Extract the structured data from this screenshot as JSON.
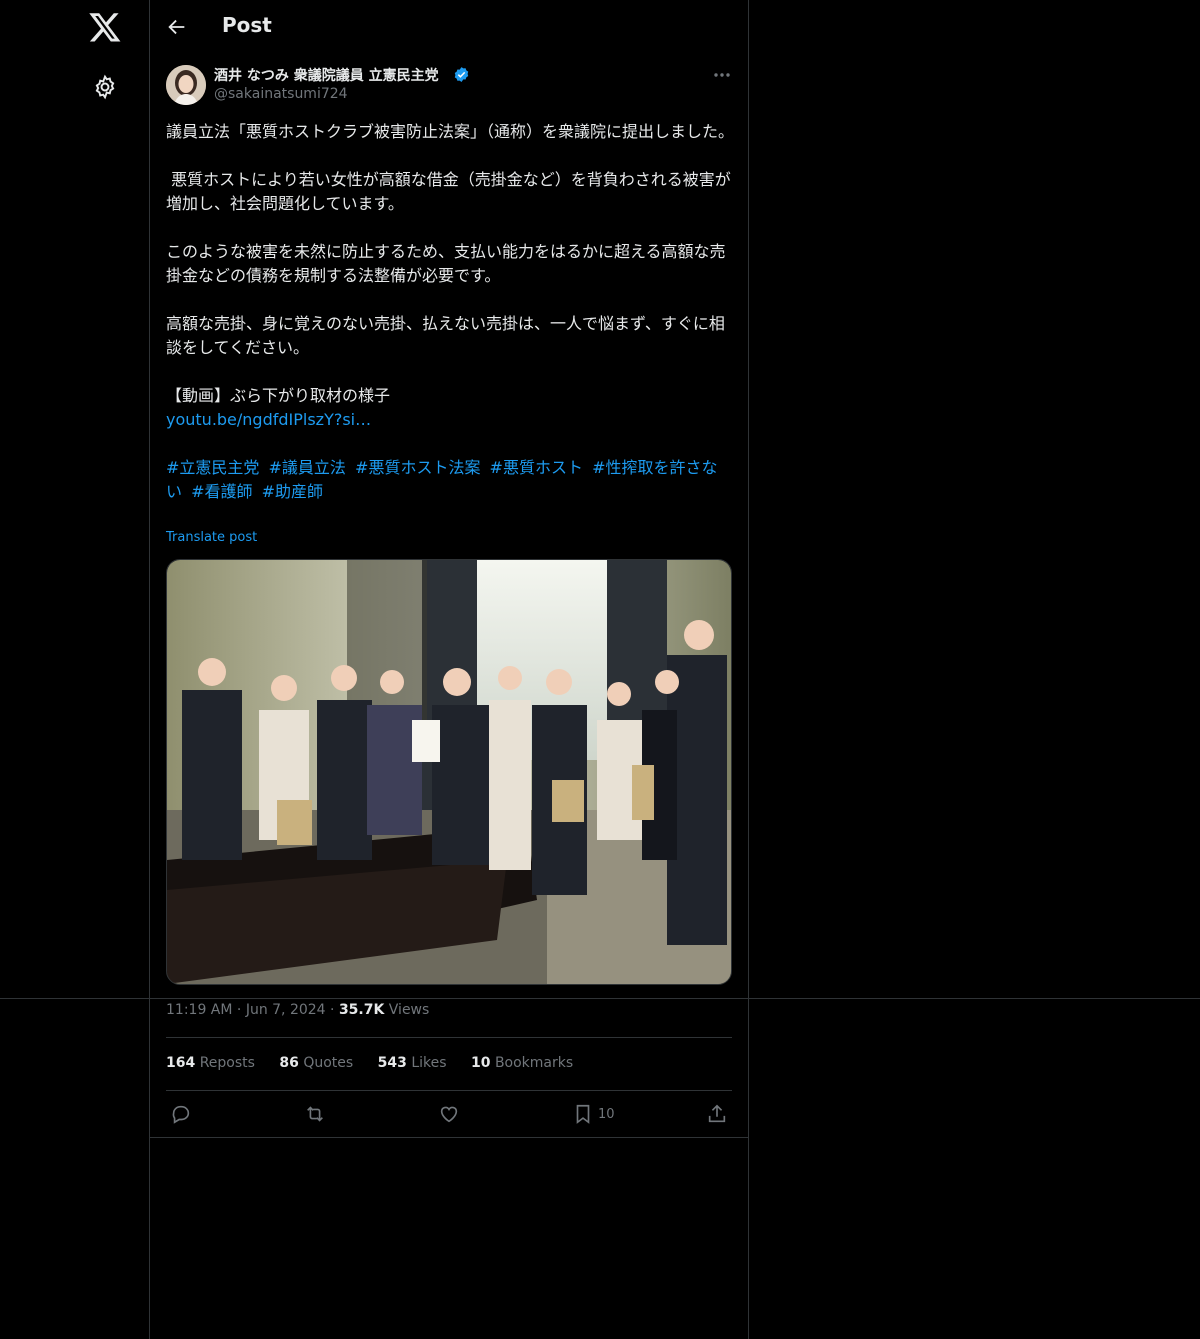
{
  "header": {
    "title": "Post"
  },
  "author": {
    "name": "酒井 なつみ 衆議院議員 立憲民主党",
    "handle": "@sakainatsumi724",
    "verified": true
  },
  "post": {
    "paragraphs": [
      "議員立法「悪質ホストクラブ被害防止法案」（通称）を衆議院に提出しました。",
      " 悪質ホストにより若い女性が高額な借金（売掛金など）を背負わされる被害が増加し、社会問題化しています。",
      "このような被害を未然に防止するため、支払い能力をはるかに超える高額な売掛金などの債務を規制する法整備が必要です。",
      "高額な売掛、身に覚えのない売掛、払えない売掛は、一人で悩まず、すぐに相談をしてください。"
    ],
    "video_label": "【動画】ぶら下がり取材の様子",
    "video_link": "youtu.be/ngdfdIPlszY?si…",
    "hashtags": [
      "#立憲民主党",
      "#議員立法",
      "#悪質ホスト法案",
      "#悪質ホスト",
      "#性搾取を許さない",
      "#看護師",
      "#助産師"
    ],
    "translate_label": "Translate post"
  },
  "meta": {
    "time": "11:19 AM",
    "date": "Jun 7, 2024",
    "views_count": "35.7K",
    "views_label": "Views"
  },
  "stats": {
    "reposts_count": "164",
    "reposts_label": "Reposts",
    "quotes_count": "86",
    "quotes_label": "Quotes",
    "likes_count": "543",
    "likes_label": "Likes",
    "bookmarks_count": "10",
    "bookmarks_label": "Bookmarks"
  },
  "actions": {
    "bookmark_count": "10"
  },
  "colors": {
    "accent": "#1d9bf0",
    "muted": "#71767b",
    "border": "#2f3336"
  }
}
